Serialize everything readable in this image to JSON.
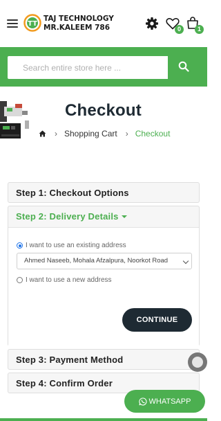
{
  "header": {
    "brand_line1": "TAJ TECHNOLOGY",
    "brand_line2": "MR.KALEEM 786",
    "logo_text": "TT",
    "wishlist_count": "0",
    "cart_count": "1"
  },
  "search": {
    "placeholder": "Search entire store here ..."
  },
  "page": {
    "title": "Checkout"
  },
  "breadcrumb": {
    "home_icon": "home-icon",
    "item1": "Shopping Cart",
    "item2": "Checkout"
  },
  "steps": {
    "step1": "Step 1: Checkout Options",
    "step2": "Step 2: Delivery Details",
    "step3": "Step 3: Payment Method",
    "step4": "Step 4: Confirm Order"
  },
  "delivery": {
    "existing_label": "I want to use an existing address",
    "selected_address": "Ahmed Naseeb, Mohala Afzalpura, Noorkot Road",
    "new_label": "I want to use a new address",
    "continue_label": "CONTINUE"
  },
  "whatsapp": {
    "label": "WHATSAPP"
  },
  "colors": {
    "accent": "#4caf50",
    "dark": "#1e2a33",
    "radio": "#1e73e8"
  }
}
